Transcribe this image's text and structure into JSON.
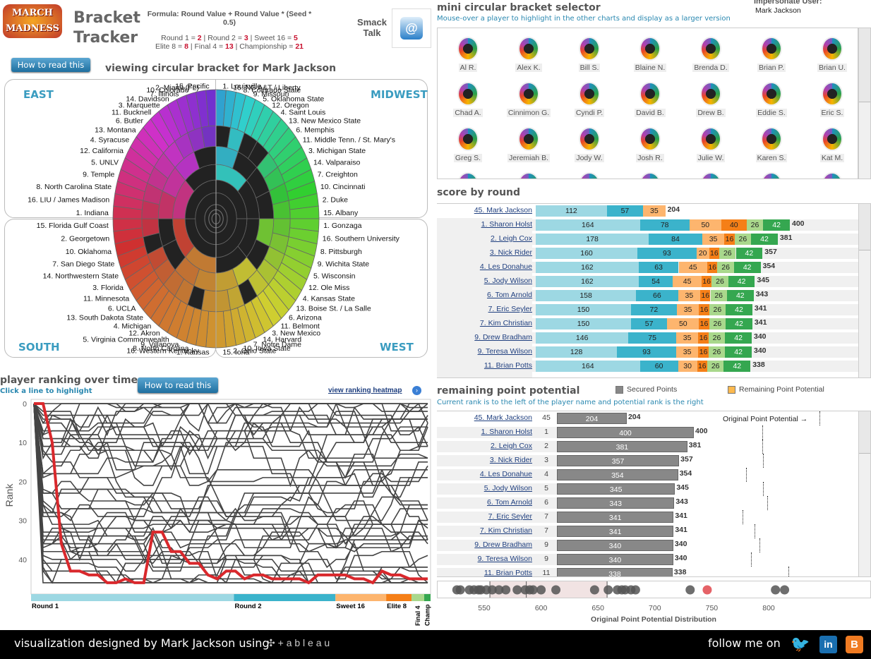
{
  "header": {
    "logo_text": "MARCH MADNESS",
    "title_line1": "Bracket",
    "title_line2": "Tracker",
    "formula": "Formula: Round Value + Round Value * (Seed * 0.5)",
    "values_line1": [
      {
        "k": "Round 1 = ",
        "v": "2"
      },
      {
        "k": " | Round 2 = ",
        "v": "3"
      },
      {
        "k": " | Sweet 16 = ",
        "v": "5"
      }
    ],
    "values_line2": [
      {
        "k": "Elite 8 = ",
        "v": "8"
      },
      {
        "k": " | Final 4 = ",
        "v": "13"
      },
      {
        "k": " | Championship = ",
        "v": "21"
      }
    ],
    "smack_talk": "Smack Talk",
    "how_to_read": "How to read this",
    "viewing": "viewing circular bracket for Mark Jackson"
  },
  "impersonate": {
    "label": "Impersonate User:",
    "value": "Mark Jackson"
  },
  "bracket": {
    "regions": {
      "east": "EAST",
      "midwest": "MIDWEST",
      "south": "SOUTH",
      "west": "WEST"
    },
    "colors": {
      "wrong": "#222222"
    },
    "midwest": [
      "1. Louisville",
      "16. NC A&T / Liberty",
      "8. Colorado State",
      "9. Missouri",
      "5. Oklahoma State",
      "12. Oregon",
      "4. Saint Louis",
      "13. New Mexico State",
      "6. Memphis",
      "11. Middle Tenn. / St. Mary's",
      "3. Michigan State",
      "14. Valparaiso",
      "7. Creighton",
      "10. Cincinnati",
      "2. Duke",
      "15. Albany"
    ],
    "west": [
      "1. Gonzaga",
      "16. Southern University",
      "8. Pittsburgh",
      "9. Wichita State",
      "5. Wisconsin",
      "12. Ole Miss",
      "4. Kansas State",
      "13. Boise St. / La Salle",
      "6. Arizona",
      "11. Belmont",
      "3. New Mexico",
      "14. Harvard",
      "7. Notre Dame",
      "10. Iowa State",
      "2. Ohio State",
      "15. Iona"
    ],
    "south": [
      "1. Kansas",
      "16. Western Kentucky",
      "8. North Carolina",
      "9. Villanova",
      "5. Virginia Commonwealth",
      "12. Akron",
      "4. Michigan",
      "13. South Dakota State",
      "6. UCLA",
      "11. Minnesota",
      "3. Florida",
      "14. Northwestern State",
      "7. San Diego State",
      "10. Oklahoma",
      "2. Georgetown",
      "15. Florida Gulf Coast"
    ],
    "east": [
      "1. Indiana",
      "16. LIU / James Madison",
      "8. North Carolina State",
      "9. Temple",
      "5. UNLV",
      "12. California",
      "4. Syracuse",
      "13. Montana",
      "6. Butler",
      "11. Bucknell",
      "3. Marquette",
      "14. Davidson",
      "7. Illinois",
      "10. Colorado",
      "2. Miami (FL)",
      "15. Pacific"
    ]
  },
  "selector": {
    "title": "mini circular bracket selector",
    "subtitle": "Mouse-over a player to highlight in the other charts and display as a larger version",
    "players": [
      "Al R.",
      "Alex K.",
      "Bill S.",
      "Blaine N.",
      "Brenda D.",
      "Brian P.",
      "Brian U.",
      "Chad A.",
      "Cinnimon G.",
      "Cyndi P.",
      "David B.",
      "Drew B.",
      "Eddie S.",
      "Eric S.",
      "Greg S.",
      "Jeremiah B.",
      "Jody W.",
      "Josh R.",
      "Julie W.",
      "Karen S.",
      "Kat M."
    ]
  },
  "score_by_round": {
    "title": "score by round",
    "round_colors": [
      "#9dd8e3",
      "#3bb3cb",
      "#fdb56e",
      "#f57f17",
      "#a9d88c",
      "#35a750"
    ],
    "selected": {
      "name": "45. Mark Jackson",
      "values": [
        112,
        57,
        35,
        0,
        0,
        0
      ],
      "total": 204
    },
    "rows": [
      {
        "name": "1. Sharon Holst",
        "values": [
          164,
          78,
          50,
          40,
          26,
          42
        ],
        "total": 400
      },
      {
        "name": "2. Leigh Cox",
        "values": [
          178,
          84,
          35,
          16,
          26,
          42
        ],
        "total": 381
      },
      {
        "name": "3. Nick Rider",
        "values": [
          160,
          93,
          20,
          16,
          26,
          42
        ],
        "total": 357
      },
      {
        "name": "4. Les Donahue",
        "values": [
          162,
          63,
          45,
          16,
          26,
          42
        ],
        "total": 354
      },
      {
        "name": "5. Jody Wilson",
        "values": [
          162,
          54,
          45,
          16,
          26,
          42
        ],
        "total": 345
      },
      {
        "name": "6. Tom Arnold",
        "values": [
          158,
          66,
          35,
          16,
          26,
          42
        ],
        "total": 343
      },
      {
        "name": "7. Eric Seyler",
        "values": [
          150,
          72,
          35,
          16,
          26,
          42
        ],
        "total": 341
      },
      {
        "name": "7. Kim Christian",
        "values": [
          150,
          57,
          50,
          16,
          26,
          42
        ],
        "total": 341
      },
      {
        "name": "9. Drew Bradham",
        "values": [
          146,
          75,
          35,
          16,
          26,
          42
        ],
        "total": 340
      },
      {
        "name": "9. Teresa Wilson",
        "values": [
          128,
          93,
          35,
          16,
          26,
          42
        ],
        "total": 340
      },
      {
        "name": "11. Brian Potts",
        "values": [
          164,
          60,
          30,
          16,
          26,
          42
        ],
        "total": 338
      }
    ]
  },
  "potential": {
    "title": "remaining point potential",
    "subtitle": "Current rank is to the left of the player name and potential rank is the right",
    "legend_secured": "Secured Points",
    "legend_remaining": "Remaining Point Potential",
    "secured_color": "#888888",
    "remaining_color": "#fdb94e",
    "original_label": "Original Point Potential",
    "selected": {
      "name": "45. Mark Jackson",
      "rank": "45",
      "secured": 204,
      "original": 767
    },
    "rows": [
      {
        "name": "1. Sharon Holst",
        "rank": "1",
        "secured": 400,
        "original": 600
      },
      {
        "name": "2. Leigh Cox",
        "rank": "2",
        "secured": 381,
        "original": 600
      },
      {
        "name": "3. Nick Rider",
        "rank": "3",
        "secured": 357,
        "original": 602
      },
      {
        "name": "4. Les Donahue",
        "rank": "4",
        "secured": 354,
        "original": 553
      },
      {
        "name": "5. Jody Wilson",
        "rank": "5",
        "secured": 345,
        "original": 602
      },
      {
        "name": "6. Tom Arnold",
        "rank": "6",
        "secured": 343,
        "original": 614
      },
      {
        "name": "7. Eric Seyler",
        "rank": "7",
        "secured": 341,
        "original": 542
      },
      {
        "name": "7. Kim Christian",
        "rank": "7",
        "secured": 341,
        "original": 577
      },
      {
        "name": "9. Drew Bradham",
        "rank": "9",
        "secured": 340,
        "original": 592
      },
      {
        "name": "9. Teresa Wilson",
        "rank": "9",
        "secured": 340,
        "original": 567
      },
      {
        "name": "11. Brian Potts",
        "rank": "11",
        "secured": 338,
        "original": 676
      }
    ]
  },
  "chart_data": [
    {
      "type": "scatter",
      "xlabel": "Original Point Potential Distribution",
      "xlim": [
        520,
        820
      ],
      "xticks": [
        550,
        600,
        650,
        700,
        750,
        800
      ],
      "values": [
        526,
        529,
        537,
        541,
        545,
        547,
        552,
        557,
        563,
        569,
        579,
        586,
        590,
        593,
        600,
        613,
        647,
        659,
        667,
        671,
        674,
        679,
        683,
        731,
        746,
        806,
        814
      ],
      "highlight_value": 746,
      "highlight_color": "#e0474c",
      "band": [
        555,
        658
      ],
      "reference_lines": [
        555,
        587,
        658
      ]
    },
    {
      "type": "line",
      "title": "player ranking over time",
      "subtitle": "Click a line to highlight",
      "ylabel": "Rank",
      "ylim": [
        0,
        47
      ],
      "yticks": [
        0,
        10,
        20,
        30,
        40
      ],
      "y_reversed": true,
      "rounds": [
        {
          "label": "Round 1",
          "games": 32,
          "color": "#9dd8e3"
        },
        {
          "label": "Round 2",
          "games": 16,
          "color": "#3bb3cb"
        },
        {
          "label": "Sweet 16",
          "games": 8,
          "color": "#fdb56e"
        },
        {
          "label": "Elite 8",
          "games": 4,
          "color": "#f57f17"
        },
        {
          "label": "Final 4",
          "games": 2,
          "color": "#a9d88c"
        },
        {
          "label": "Champ",
          "games": 1,
          "color": "#35a750"
        }
      ],
      "highlight": {
        "name": "Mark Jackson",
        "color": "#d9282c",
        "ranks": [
          0,
          0,
          10,
          36,
          43,
          43,
          44,
          44,
          46,
          46,
          45,
          46,
          46,
          33,
          33,
          38,
          38,
          41,
          41,
          44,
          45,
          43,
          43,
          45,
          44,
          44,
          45,
          45,
          45,
          45,
          46,
          44,
          44,
          44,
          44,
          45,
          45,
          46,
          43,
          44,
          44,
          45,
          45,
          45
        ]
      },
      "other_series_count": 45,
      "line_color": "#444444"
    }
  ],
  "ranking": {
    "how_to_read": "How to read this",
    "heatmap_link": "view ranking heatmap"
  },
  "footer": {
    "text": "visualization designed by Mark Jackson using",
    "tableau": "+ a b l e a u",
    "follow": "follow me on"
  }
}
